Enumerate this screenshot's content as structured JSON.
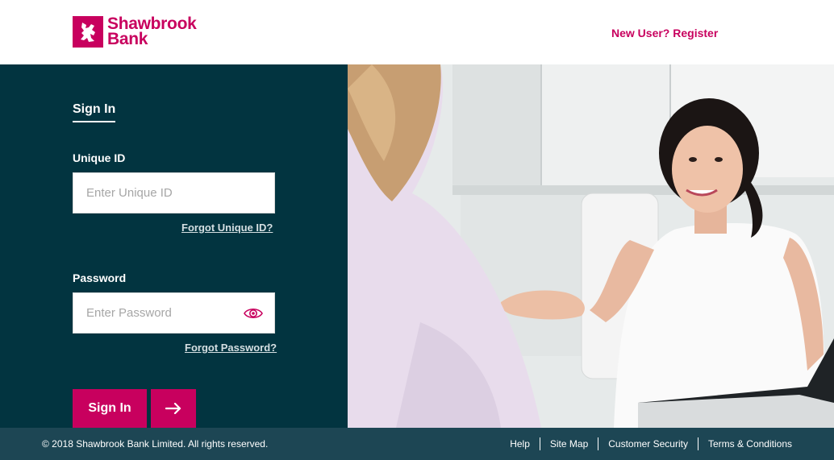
{
  "brand": {
    "name_line1": "Shawbrook",
    "name_line2": "Bank",
    "color": "#c8005e"
  },
  "header": {
    "register_link": "New User? Register"
  },
  "signin": {
    "heading": "Sign In",
    "unique_id": {
      "label": "Unique ID",
      "placeholder": "Enter Unique ID",
      "value": "",
      "forgot_link": "Forgot Unique ID?"
    },
    "password": {
      "label": "Password",
      "placeholder": "Enter Password",
      "value": "",
      "toggle_icon": "eye-icon",
      "forgot_link": "Forgot Password?"
    },
    "submit_label": "Sign In",
    "submit_icon": "arrow-right-icon"
  },
  "footer": {
    "copyright": "© 2018 Shawbrook Bank Limited. All rights reserved.",
    "links": [
      "Help",
      "Site Map",
      "Customer Security",
      "Terms & Conditions"
    ]
  },
  "colors": {
    "panel": "#023440",
    "footer": "#1d4654",
    "accent": "#c8005e"
  }
}
